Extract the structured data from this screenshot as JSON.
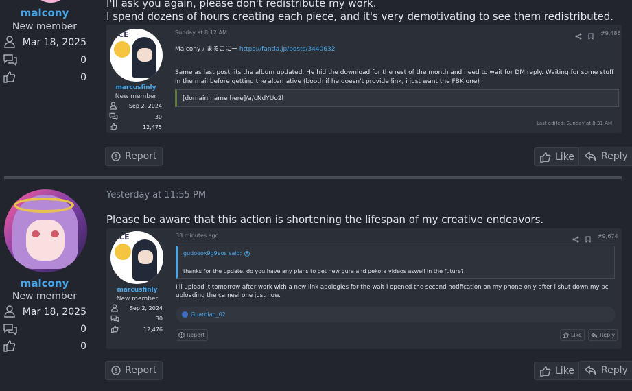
{
  "post1": {
    "author": {
      "name": "malcony",
      "title": "New member",
      "joined": "Mar 18, 2025",
      "messages": "0",
      "reactions": "0"
    },
    "body_line1": "I'll ask you again, please don't redistribute my work.",
    "body_line2": "I spend dozens of hours creating each piece, and it's very demotivating to see them redistributed.",
    "quote": {
      "avatar_text": "ICE",
      "author": {
        "name": "marcusfinly",
        "title": "New member",
        "joined": "Sep 2, 2024",
        "messages": "30",
        "reactions": "12,475"
      },
      "date": "Sunday at 8:12 AM",
      "post_number": "#9,486",
      "line_prefix": "Malcony / まるこにー",
      "link": "https://fantia.jp/posts/3440632",
      "paragraph": "Same as last post, its the album updated. He hid the download for the rest of the month and need to wait for DM reply. Waiting for some stuff in the mail before getting the alternative (booth if he doesn't provide link, i just want the FBK one)",
      "code": "[domain name here]/a/cNdYUo2l",
      "last_edited": "Last edited: Sunday at 8:31 AM"
    },
    "actions": {
      "report": "Report",
      "like": "Like",
      "reply": "Reply"
    }
  },
  "post2": {
    "author": {
      "name": "malcony",
      "title": "New member",
      "joined": "Mar 18, 2025",
      "messages": "0",
      "reactions": "0"
    },
    "date": "Yesterday at 11:55 PM",
    "body": "Please be aware that this action is shortening the lifespan of my creative endeavors.",
    "quote": {
      "avatar_text": "ICE",
      "author": {
        "name": "marcusfinly",
        "title": "New member",
        "joined": "Sep 2, 2024",
        "messages": "30",
        "reactions": "12,476"
      },
      "date": "38 minutes ago",
      "post_number": "#9,674",
      "inner_quote_author": "gudoeox9g9eos said:",
      "inner_quote_text": "thanks for the update. do you have any plans to get new gura and pekora videos aswell in the future?",
      "paragraph": "I'll upload it tomorrow after work with a new link apologies for the wait i opened the second notification on my phone only after i shut down my pc uploading the cameel one just now.",
      "reaction_user": "Guardian_02",
      "actions": {
        "report": "Report",
        "like": "Like",
        "reply": "Reply"
      }
    },
    "actions": {
      "report": "Report",
      "like": "Like",
      "reply": "Reply"
    }
  },
  "colors": {
    "background": "#22252e",
    "username": "#47a7eb",
    "quote_bg": "#2b2f38",
    "divider": "#474c55"
  }
}
